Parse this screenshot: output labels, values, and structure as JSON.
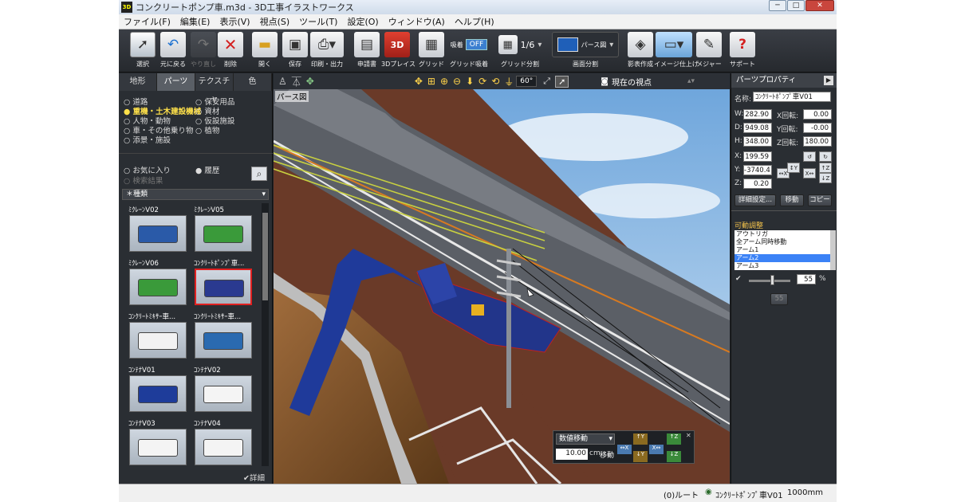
{
  "window": {
    "title": "コンクリートポンプ車.m3d - 3D工事イラストワークス",
    "app_icon": "3D"
  },
  "menu": [
    "ファイル(F)",
    "編集(E)",
    "表示(V)",
    "視点(S)",
    "ツール(T)",
    "設定(O)",
    "ウィンドウ(A)",
    "ヘルプ(H)"
  ],
  "toolbar": [
    {
      "label": "選択",
      "icon": "cursor-icon"
    },
    {
      "label": "元に戻る",
      "icon": "undo-icon"
    },
    {
      "label": "やり直し",
      "icon": "redo-icon",
      "disabled": true
    },
    {
      "label": "削除",
      "icon": "delete-icon"
    },
    {
      "label": "開く",
      "icon": "folder-icon"
    },
    {
      "label": "保存",
      "icon": "save-icon"
    },
    {
      "label": "印刷・出力",
      "icon": "printer-icon"
    },
    {
      "label": "申請書",
      "icon": "document-icon"
    },
    {
      "label": "3Dプレイス",
      "icon": "3d-place-icon"
    },
    {
      "label": "グリッド",
      "icon": "grid-icon"
    },
    {
      "label": "グリッド吸着",
      "icon": "snap-icon",
      "badge": "吸着",
      "toggle": "OFF"
    },
    {
      "label": "グリッド分割",
      "icon": "grid-split-icon",
      "value": "1/6"
    },
    {
      "label": "画面分割",
      "icon": "screen-split-icon",
      "value": "パース図"
    },
    {
      "label": "影表作成",
      "icon": "shadow-icon"
    },
    {
      "label": "イメージ仕上げ",
      "icon": "image-finish-icon"
    },
    {
      "label": "メジャー",
      "icon": "measure-icon"
    },
    {
      "label": "サポート",
      "icon": "support-icon"
    }
  ],
  "left_panel": {
    "tabs": [
      "地形",
      "パーツ",
      "テクスチャ",
      "色"
    ],
    "active_tab": "パーツ",
    "categories_left": [
      "道路",
      "重機・土木建設機械",
      "人物・動物",
      "車・その他乗り物",
      "添景・施設"
    ],
    "categories_right": [
      "保安用品",
      "資材",
      "仮設施設",
      "植物"
    ],
    "highlighted_category": "重機・土木建設機械",
    "favorites_label": "お気に入り",
    "history_label": "履歴",
    "search_sub": "検索結果",
    "type_dropdown": "種類",
    "thumbs": [
      {
        "label": "ﾐｸﾚｰﾝV02",
        "color": "#2a5aa8"
      },
      {
        "label": "ﾐｸﾚｰﾝV05",
        "color": "#3a9a3a"
      },
      {
        "label": "ﾐｸﾚｰﾝV06",
        "color": "#3a9a3a"
      },
      {
        "label": "ｺﾝｸﾘｰﾄﾎﾟﾝﾌﾟ車...",
        "color": "#2a3a90",
        "selected": true
      },
      {
        "label": "ｺﾝｸﾘｰﾄﾐｷｻｰ車...",
        "color": "#f2f2f2"
      },
      {
        "label": "ｺﾝｸﾘｰﾄﾐｷｻｰ車...",
        "color": "#2a6ab0"
      },
      {
        "label": "ｺﾝﾃﾅV01",
        "color": "#1e3c9a"
      },
      {
        "label": "ｺﾝﾃﾅV02",
        "color": "#f4f4f4"
      },
      {
        "label": "ｺﾝﾃﾅV03",
        "color": "#f4f4f4"
      },
      {
        "label": "ｺﾝﾃﾅV04",
        "color": "#f4f4f4"
      }
    ],
    "detail_checkbox": "詳細"
  },
  "view_toolbar": {
    "angle": "60°",
    "viewpoint": "現在の視点",
    "view_label": "パース図"
  },
  "move_popup": {
    "mode": "数値移動",
    "value": "10.00",
    "unit": "cm",
    "action": "移動"
  },
  "right_panel": {
    "title": "パーツプロパティ",
    "name_label": "名称:",
    "name_value": "ｺﾝｸﾘｰﾄﾎﾟﾝﾌﾟ車V01",
    "dims": [
      {
        "label": "W:",
        "value": "282.90",
        "rot_label": "X回転:",
        "rot": "0.00"
      },
      {
        "label": "D:",
        "value": "949.08",
        "rot_label": "Y回転:",
        "rot": "-0.00"
      },
      {
        "label": "H:",
        "value": "348.00",
        "rot_label": "Z回転:",
        "rot": "180.00"
      }
    ],
    "pos": [
      {
        "label": "X:",
        "value": "199.59"
      },
      {
        "label": "Y:",
        "value": "-3740.4"
      },
      {
        "label": "Z:",
        "value": "0.20"
      }
    ],
    "buttons": [
      "詳細設定...",
      "移動",
      "コピー"
    ],
    "movable_title": "可動調整",
    "movable_items": [
      "アウトリガ",
      "全アーム同時移動",
      "アーム1",
      "アーム2",
      "アーム3"
    ],
    "movable_selected": "アーム2",
    "slider_value": "55",
    "slider_fraction": 0.55,
    "slider_unit": "%",
    "small_btn": "55"
  },
  "status": {
    "left": "(0)ルート",
    "part": "ｺﾝｸﾘｰﾄﾎﾟﾝﾌﾟ車V01",
    "unit": "1000mm"
  },
  "colors": {
    "accent_select": "#3b82f6",
    "highlight_category": "#ffe14a",
    "selected_thumb_border": "#e02020"
  }
}
